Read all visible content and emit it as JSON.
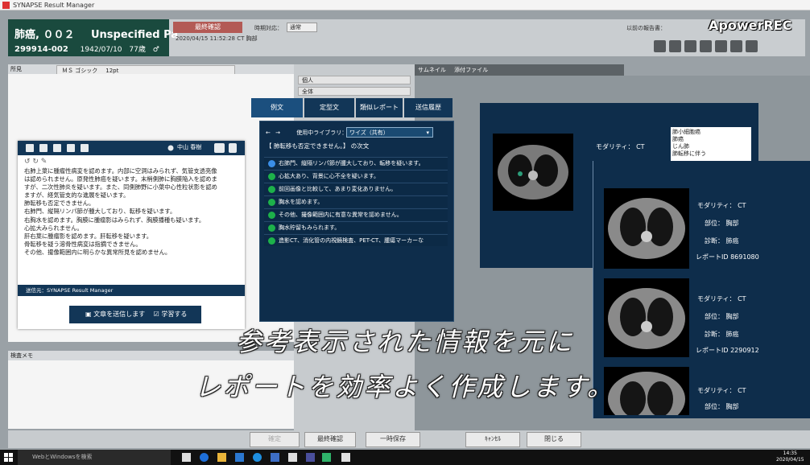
{
  "window": {
    "title": "SYNAPSE Result Manager"
  },
  "watermark": "ApowerREC",
  "patient": {
    "name": "肺癌, ００２",
    "sex_label": "Unspecified Pa",
    "id": "299914-002",
    "birth": "1942/07/10",
    "age": "77歳"
  },
  "header": {
    "final_status": "最終確認",
    "exam_datetime": "2020/04/15 11:52:28  CT  胸部",
    "unit_label": "時期対応：",
    "unit_value": "通常",
    "previous_label": "以前の報告書："
  },
  "findings": {
    "label": "所見",
    "font": "ＭＳ ゴシック",
    "size": "12pt"
  },
  "note": {
    "user": "中山 春樹",
    "lines": [
      "右肺上葉に腫瘤性病変を認めます。内部に空洞はみられず、気管支透亮像",
      "は認められません。原発性肺癌を疑います。末梢側肺に胸膜陥入を認めま",
      "すが、二次性肺炎を疑います。また、同側肺野に小葉中心性粒状影を認め",
      "ますが、経気管支的な進展を疑います。",
      "肺転移も否定できません。",
      "右肺門、縦隔リンパ節が腫大しており、転移を疑います。",
      "右胸水を認めます。胸膜に腫瘤影はみられず、胸膜播種も疑います。",
      "心拡大みられません。",
      "肝右葉に腫瘤影を認めます。肝転移を疑います。",
      "骨転移を疑う溶骨性病変は指摘できません。",
      "その他、撮像範囲内に明らかな異常所見を認めません。"
    ],
    "footer": "送信元：SYNAPSE Result Manager",
    "send_label": "文章を送信します",
    "learn_label": "学習する"
  },
  "memo": {
    "label": "検査メモ"
  },
  "middle": {
    "rows": [
      "個人",
      "全体"
    ]
  },
  "thumbnails": {
    "tabs": [
      "サムネイル",
      "添付ファイル"
    ]
  },
  "template_panel": {
    "tabs": [
      "例文",
      "定型文",
      "類似レポート",
      "送信履歴"
    ],
    "library_label": "使用中ライブラリ：",
    "library_value": "ワイズ（共有）",
    "heading": "【 肺転移も否定できません。】 の次文",
    "items": [
      "右肺門、縦隔リンパ節が腫大しており、転移を疑います。",
      "心拡大あり、背景に心不全を疑います。",
      "前回画像と比較して、あまり変化ありません。",
      "胸水を認めます。",
      "その他、撮像範囲内に有意な異常を認めません。",
      "胸水貯留もみられます。",
      "造影CT、消化管の内視鏡検査、PET-CT、腫瘍マーカーな"
    ]
  },
  "similar": {
    "panel1": {
      "modality_label": "モダリティ：",
      "modality": "CT",
      "list": [
        "肺小細胞癌",
        "肺癌",
        "じん肺",
        "肺転移に伴う"
      ]
    },
    "cards": [
      {
        "modality_label": "モダリティ：",
        "modality": "CT",
        "part_label": "部位：",
        "part": "胸部",
        "diag_label": "診断：",
        "diag": "肺癌",
        "report_label": "レポートID",
        "report_id": "8691080"
      },
      {
        "modality_label": "モダリティ：",
        "modality": "CT",
        "part_label": "部位：",
        "part": "胸部",
        "diag_label": "診断：",
        "diag": "肺癌",
        "report_label": "レポートID",
        "report_id": "2290912"
      },
      {
        "modality_label": "モダリティ：",
        "modality": "CT",
        "part_label": "部位：",
        "part": "胸部"
      }
    ]
  },
  "subtitles": [
    "参考表示された情報を元に",
    "レポートを効率よく作成します。"
  ],
  "buttons": {
    "confirm": "確定",
    "final_confirm": "最終確認",
    "temp_save": "一時保存",
    "cancel": "ｷｬﾝｾﾙ",
    "close": "閉じる"
  },
  "taskbar": {
    "search_placeholder": "WebとWindowsを検索",
    "time": "14:35",
    "date": "2020/04/15"
  }
}
